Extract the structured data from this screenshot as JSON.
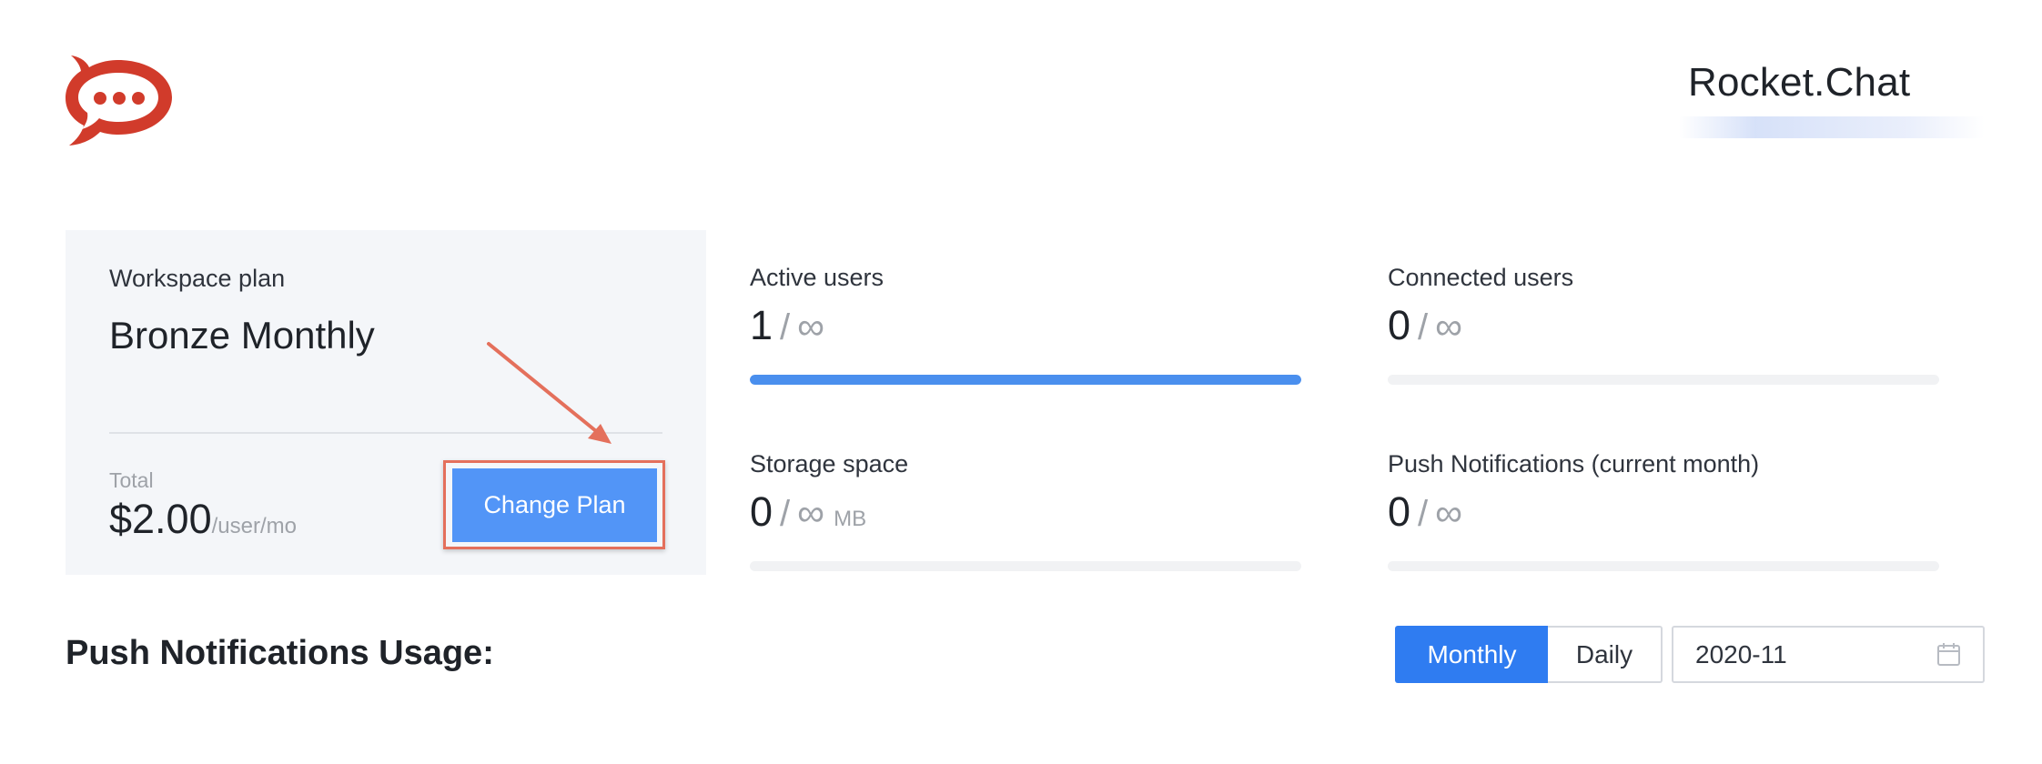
{
  "header": {
    "logo": "rocket-chat-logo",
    "brand_name": "Rocket.Chat"
  },
  "plan": {
    "label": "Workspace plan",
    "name": "Bronze Monthly",
    "total_label": "Total",
    "total_amount": "$2.00",
    "total_unit": "/user/mo",
    "change_button": "Change Plan"
  },
  "stats": {
    "active_users": {
      "label": "Active users",
      "value": "1",
      "separator": "/",
      "limit": "∞",
      "fill_fraction": 1.0
    },
    "connected_users": {
      "label": "Connected users",
      "value": "0",
      "separator": "/",
      "limit": "∞",
      "fill_fraction": 0
    },
    "storage_space": {
      "label": "Storage space",
      "value": "0",
      "separator": "/",
      "limit": "∞",
      "unit": "MB",
      "fill_fraction": 0
    },
    "push_notifications": {
      "label": "Push Notifications (current month)",
      "value": "0",
      "separator": "/",
      "limit": "∞",
      "fill_fraction": 0
    }
  },
  "usage": {
    "title": "Push Notifications Usage:",
    "period_options": [
      "Monthly",
      "Daily"
    ],
    "selected_period": "Monthly",
    "date_value": "2020-11",
    "date_icon": "calendar-icon"
  },
  "colors": {
    "accent": "#2f7cf1",
    "button": "#5295f7",
    "bar_fill": "#4a8fee",
    "logo": "#d13b2b",
    "annotation": "#e4705c"
  }
}
